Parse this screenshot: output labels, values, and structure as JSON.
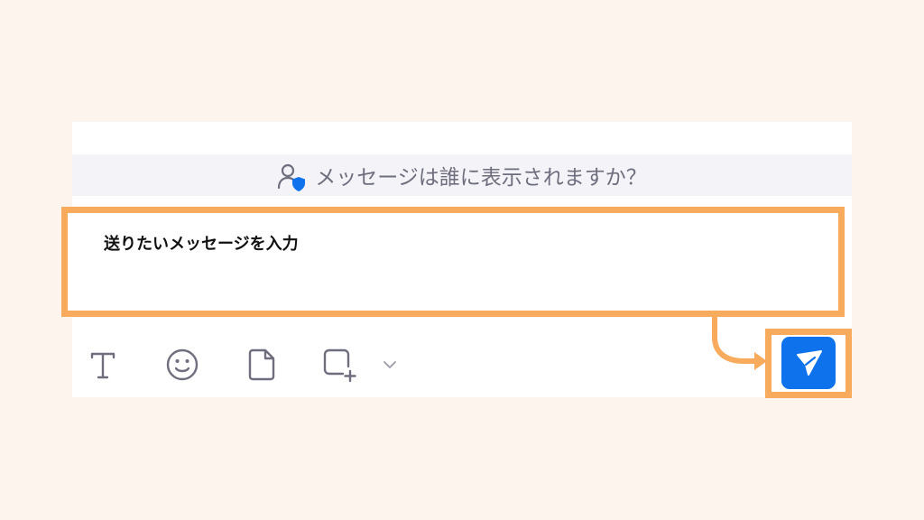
{
  "visibility_bar": {
    "text": "メッセージは誰に表示されますか？",
    "icon": "user-shield-icon"
  },
  "message_input": {
    "placeholder": "送りたいメッセージを入力"
  },
  "toolbar": {
    "icons": [
      "text-format-icon",
      "emoji-icon",
      "file-icon",
      "screenshot-icon",
      "chevron-down-icon"
    ]
  },
  "send_button": {
    "icon": "send-icon",
    "color": "#0e72ed"
  },
  "highlight_color": "#f8ab5c"
}
